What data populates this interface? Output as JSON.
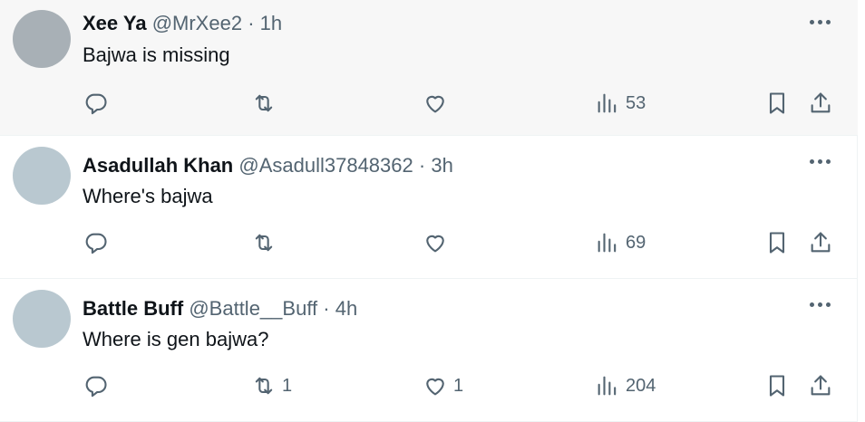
{
  "colors": {
    "avatar_1": "#a8b0b6",
    "avatar_2": "#b9c8d0",
    "avatar_3": "#b9c8d0",
    "highlight_bg": "#f7f7f7",
    "secondary_text": "#536471"
  },
  "tweets": [
    {
      "name": "Xee Ya",
      "handle": "@MrXee2",
      "separator": "·",
      "time": "1h",
      "text": "Bajwa is missing",
      "reply_count": "",
      "retweet_count": "",
      "like_count": "",
      "views_count": "53"
    },
    {
      "name": "Asadullah Khan",
      "handle": "@Asadull37848362",
      "separator": "·",
      "time": "3h",
      "text": "Where's bajwa",
      "reply_count": "",
      "retweet_count": "",
      "like_count": "",
      "views_count": "69"
    },
    {
      "name": "Battle Buff",
      "handle": "@Battle__Buff",
      "separator": "·",
      "time": "4h",
      "text": "Where is gen bajwa?",
      "reply_count": "",
      "retweet_count": "1",
      "like_count": "1",
      "views_count": "204"
    }
  ],
  "icons": {
    "reply": "reply-icon",
    "retweet": "retweet-icon",
    "like": "heart-icon",
    "views": "views-icon",
    "bookmark": "bookmark-icon",
    "share": "share-icon",
    "more": "more-icon"
  }
}
